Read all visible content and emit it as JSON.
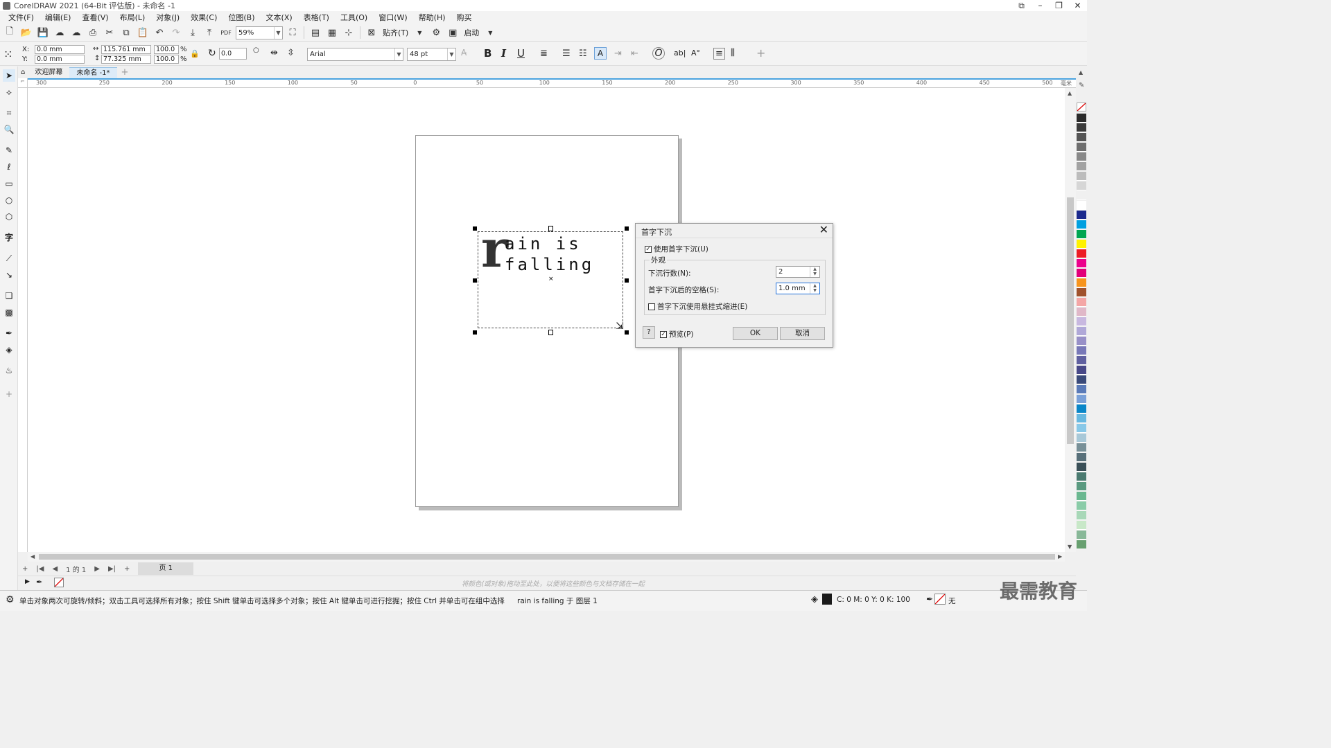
{
  "window": {
    "title": "CorelDRAW 2021 (64-Bit 评估版) - 未命名 -1"
  },
  "menu": [
    "文件(F)",
    "编辑(E)",
    "查看(V)",
    "布局(L)",
    "对象(J)",
    "效果(C)",
    "位图(B)",
    "文本(X)",
    "表格(T)",
    "工具(O)",
    "窗口(W)",
    "帮助(H)",
    "购买"
  ],
  "toolbar": {
    "zoom": "59%",
    "snap_label": "贴齐(T)",
    "launch_label": "启动",
    "pdf_label": "PDF"
  },
  "properties": {
    "x": "0.0 mm",
    "y": "0.0 mm",
    "width": "115.761 mm",
    "height": "77.325 mm",
    "scale_w": "100.0",
    "scale_h": "100.0",
    "percent": "%",
    "angle": "0.0",
    "font": "Arial",
    "font_size": "48 pt",
    "x_label": "X:",
    "y_label": "Y:"
  },
  "tabs": {
    "welcome": "欢迎屏幕",
    "document": "未命名 -1*"
  },
  "ruler": {
    "h_labels": [
      "300",
      "250",
      "200",
      "150",
      "100",
      "50",
      "0",
      "50",
      "100",
      "150",
      "200",
      "250",
      "300",
      "350",
      "400",
      "450",
      "500"
    ],
    "unit": "毫米"
  },
  "text_object": {
    "dropcap": "r",
    "line1": "ain is",
    "line2": "falling"
  },
  "dialog": {
    "title": "首字下沉",
    "use_dropcap": "使用首字下沉(U)",
    "group_label": "外观",
    "lines_label": "下沉行数(N):",
    "lines_value": "2",
    "space_label": "首字下沉后的空格(S):",
    "space_value": "1.0 mm",
    "hanging_indent": "首字下沉使用悬挂式缩进(E)",
    "help": "?",
    "preview": "预览(P)",
    "ok": "OK",
    "cancel": "取消"
  },
  "page_nav": {
    "current": "1",
    "of": "的",
    "total": "1",
    "page_tab": "页 1"
  },
  "color_hint": "将颜色(或对象)拖动至此处，以便将这些颜色与文档存储在一起",
  "status": {
    "hint": "单击对象两次可旋转/倾斜；双击工具可选择所有对象；按住 Shift 键单击可选择多个对象；按住 Alt 键单击可进行挖掘；按住 Ctrl 并单击可在组中选择",
    "object_info": "rain is falling 于 图层 1",
    "fill_values": "C: 0 M: 0 Y: 0 K: 100",
    "outline": "无"
  },
  "watermark": "最需教育",
  "palette_colors": [
    "#2b2b2b",
    "#3b3b3b",
    "#555555",
    "#6e6e6e",
    "#888888",
    "#a2a2a2",
    "#bcbcbc",
    "#d6d6d6",
    "#f0f0f0",
    "#ffffff",
    "#1b2a8e",
    "#00a0e0",
    "#00a651",
    "#fff200",
    "#ed1c24",
    "#ec008c",
    "#e2007a",
    "#f7941d",
    "#a0522d",
    "#f4a6a6",
    "#e0b8c8",
    "#c8b8e0",
    "#b0a8d8",
    "#9890c8",
    "#7878b8",
    "#6060a0",
    "#484888",
    "#3a4a7a",
    "#5a7ab8",
    "#7aa0d8",
    "#0a86c8",
    "#68b8e0",
    "#88c8e8",
    "#a8c8d8",
    "#789098",
    "#58707a",
    "#3a5058",
    "#4a7a70",
    "#5a9a80",
    "#6ab890",
    "#8acca8",
    "#a8d8b8",
    "#c8e8c8",
    "#88b898",
    "#68a070"
  ]
}
